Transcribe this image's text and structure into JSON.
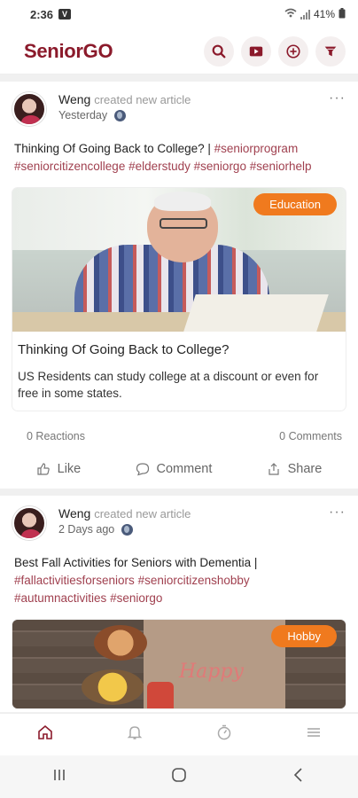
{
  "status_bar": {
    "time": "2:36",
    "notification_glyph": "V",
    "battery": "41%"
  },
  "header": {
    "brand": "SeniorGO",
    "actions": [
      "search-icon",
      "video-icon",
      "add-circle-icon",
      "filter-icon"
    ]
  },
  "posts": [
    {
      "author": "Weng",
      "action": "created new article",
      "time": "Yesterday",
      "text": "Thinking Of Going Back to College? |",
      "tags": [
        "#seniorprogram",
        "#seniorcitizencollege",
        "#elderstudy",
        "#seniorgo",
        "#seniorhelp"
      ],
      "card": {
        "badge": "Education",
        "title": "Thinking Of Going Back to College?",
        "description": "US Residents can study college at a discount or even for free in some states."
      },
      "reactions": "0 Reactions",
      "comments": "0 Comments",
      "actions": {
        "like": "Like",
        "comment": "Comment",
        "share": "Share"
      }
    },
    {
      "author": "Weng",
      "action": "created new article",
      "time": "2 Days ago",
      "text": "Best Fall Activities for Seniors with Dementia |",
      "tags": [
        "#fallactivitiesforseniors",
        "#seniorcitizenshobby",
        "#autumnactivities",
        "#seniorgo"
      ],
      "card": {
        "badge": "Hobby",
        "image_text": "Happy"
      }
    }
  ],
  "colors": {
    "brand": "#8b1a2b",
    "tag": "#a0404f",
    "badge": "#f07a1e"
  }
}
